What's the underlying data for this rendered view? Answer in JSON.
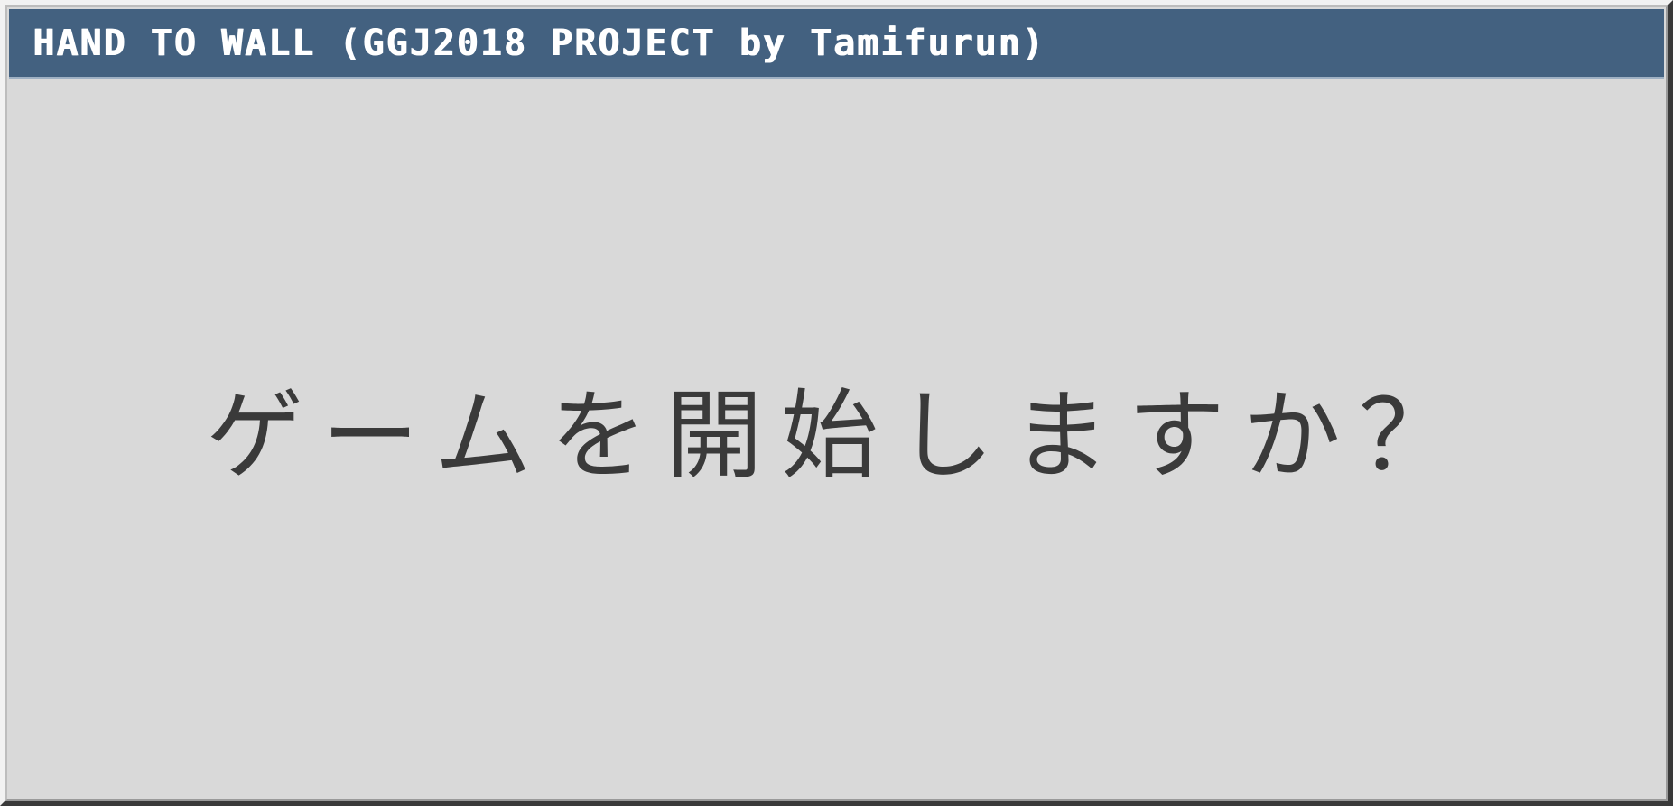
{
  "window": {
    "title": "HAND TO WALL (GGJ2018 PROJECT by Tamifurun)"
  },
  "dialog": {
    "prompt": "ゲームを開始しますか？"
  },
  "colors": {
    "title_bar": "#436180",
    "window_background": "#d9d9d9",
    "text": "#3a3a3a",
    "title_text": "#ffffff"
  }
}
